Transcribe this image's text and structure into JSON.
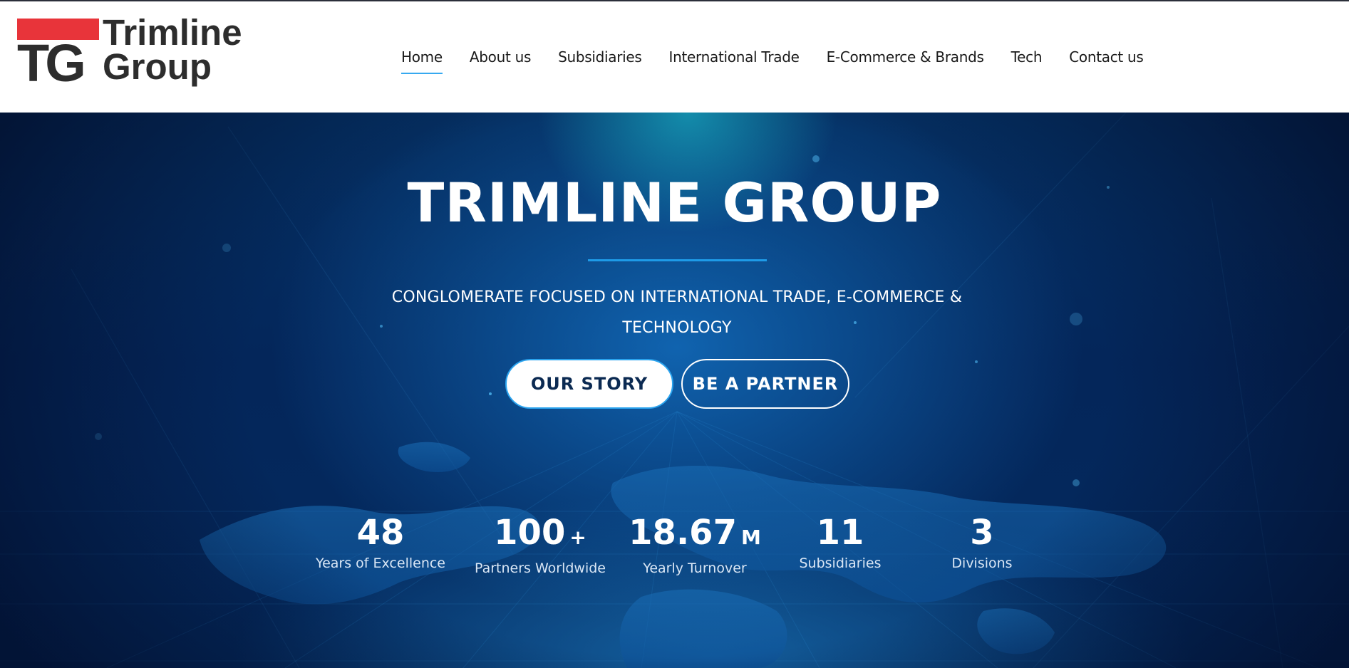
{
  "brand": {
    "logo_mark": "TG",
    "logo_name_line1": "Trimline",
    "logo_name_line2": "Group"
  },
  "nav": {
    "items": [
      {
        "label": "Home",
        "active": true
      },
      {
        "label": "About us"
      },
      {
        "label": "Subsidiaries"
      },
      {
        "label": "International Trade"
      },
      {
        "label": "E-Commerce & Brands"
      },
      {
        "label": "Tech"
      },
      {
        "label": "Contact us"
      }
    ]
  },
  "hero": {
    "title": "TRIMLINE GROUP",
    "subtitle_line1": "CONGLOMERATE FOCUSED ON INTERNATIONAL TRADE, E-COMMERCE &",
    "subtitle_line2": "TECHNOLOGY",
    "buttons": {
      "story": "OUR STORY",
      "partner": "BE A PARTNER"
    }
  },
  "stats": [
    {
      "value": "48",
      "suffix": "",
      "label": "Years of Excellence"
    },
    {
      "value": "100",
      "suffix": "+",
      "label": "Partners Worldwide"
    },
    {
      "value": "18.67",
      "suffix": "M",
      "label": "Yearly Turnover"
    },
    {
      "value": "11",
      "suffix": "",
      "label": "Subsidiaries"
    },
    {
      "value": "3",
      "suffix": "",
      "label": "Divisions"
    }
  ],
  "colors": {
    "accent": "#1e9be8",
    "logo_red": "#e8343a",
    "hero_bg": "#04265a",
    "button_text": "#0b2a52"
  }
}
